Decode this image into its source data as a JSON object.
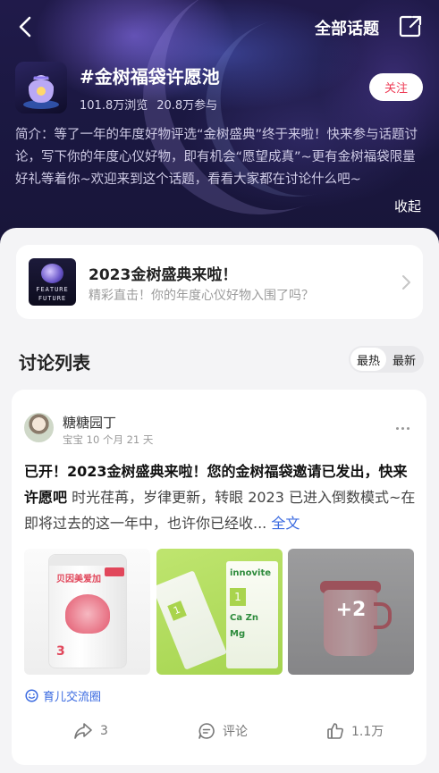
{
  "header": {
    "all_topics_label": "全部话题",
    "icons": {
      "back": "back-arrow-icon",
      "share": "share-icon"
    }
  },
  "topic": {
    "title": "#金树福袋许愿池",
    "views": "101.8万浏览",
    "participants": "20.8万参与",
    "follow_label": "关注",
    "description": "简介：等了一年的年度好物评选“金树盛典”终于来啦！快来参与话题讨论，写下你的年度心仪好物，即有机会“愿望成真”~更有金树福袋限量好礼等着你~欢迎来到这个话题，看看大家都在讨论什么吧~",
    "collapse_label": "收起"
  },
  "banner": {
    "title": "2023金树盛典来啦！",
    "subtitle": "精彩直击！你的年度心仪好物入围了吗？",
    "thumb_line1": "FEATURE",
    "thumb_line2": "FUTURE"
  },
  "discussion": {
    "title": "讨论列表",
    "sort_hot": "最热",
    "sort_new": "最新"
  },
  "post": {
    "username": "糖糖园丁",
    "meta": "宝宝 10 个月 21 天",
    "headline": "已开！2023金树盛典来啦！您的金树福袋邀请已发出，快来许愿吧",
    "body": " 时光荏苒，岁律更新，转眼 2023 已进入倒数模式~在即将过去的这一年中，也许你已经收... ",
    "full_text_link": "全文",
    "image1_brand": "贝因美爱加",
    "image1_num": "3",
    "image2_brand": "innovite",
    "image2_line1": "Ca Zn",
    "image2_line2": "Mg",
    "image2_digit": "1",
    "more_images": "+2",
    "circle": "育儿交流圈",
    "shares": "3",
    "comment_label": "评论",
    "likes": "1.1万"
  }
}
